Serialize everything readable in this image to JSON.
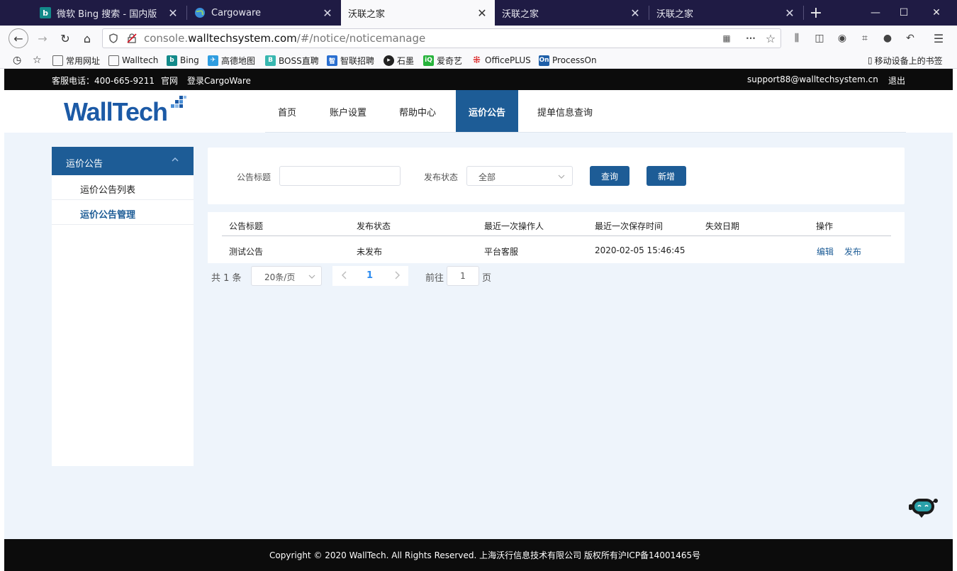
{
  "browser": {
    "tabs": [
      {
        "title": "微软 Bing 搜索 - 国内版",
        "icon": "bing-icon"
      },
      {
        "title": "Cargoware",
        "icon": "globe-icon"
      },
      {
        "title": "沃联之家",
        "icon": ""
      },
      {
        "title": "沃联之家",
        "icon": ""
      },
      {
        "title": "沃联之家",
        "icon": ""
      }
    ],
    "active_tab": 2,
    "url_host": "console.",
    "url_domain": "walltechsystem.com",
    "url_path": "/#/notice/noticemanage",
    "bookmarks": [
      "常用网址",
      "Walltech",
      "Bing",
      "高德地图",
      "BOSS直聘",
      "智联招聘",
      "石墨",
      "爱奇艺",
      "OfficePLUS",
      "ProcessOn"
    ],
    "mobile_bookmarks": "移动设备上的书签"
  },
  "topstrip": {
    "phone": "客服电话：400-665-9211",
    "official": "官网",
    "login": "登录CargoWare",
    "email": "support88@walltechsystem.cn",
    "logout": "退出"
  },
  "header": {
    "logo_text": "WallTech",
    "menu": [
      "首页",
      "账户设置",
      "帮助中心",
      "运价公告",
      "提单信息查询"
    ],
    "active_menu": "运价公告"
  },
  "sidebar": {
    "title": "运价公告",
    "items": [
      "运价公告列表",
      "运价公告管理"
    ],
    "active_item": "运价公告管理"
  },
  "filter": {
    "title_label": "公告标题",
    "title_value": "",
    "status_label": "发布状态",
    "status_value": "全部",
    "search_button": "查询",
    "add_button": "新增"
  },
  "table": {
    "columns": [
      "公告标题",
      "发布状态",
      "最近一次操作人",
      "最近一次保存时间",
      "失效日期",
      "操作"
    ],
    "rows": [
      {
        "title": "测试公告",
        "status": "未发布",
        "operator": "平台客服",
        "saved_at": "2020-02-05 15:46:45",
        "expire": "",
        "actions": [
          "编辑",
          "发布"
        ]
      }
    ]
  },
  "pagination": {
    "total": "共 1 条",
    "page_size": "20条/页",
    "current": "1",
    "goto_label": "前往",
    "goto_value": "1",
    "goto_unit": "页"
  },
  "footer": {
    "copyright": "Copyright © 2020 WallTech. All Rights Reserved. 上海沃行信息技术有限公司 版权所有沪ICP备14001465号"
  },
  "colors": {
    "brand": "#1d5c96",
    "tabbar": "#1f1b44",
    "page_bg": "#eef4fb",
    "link": "#1d5c96"
  }
}
